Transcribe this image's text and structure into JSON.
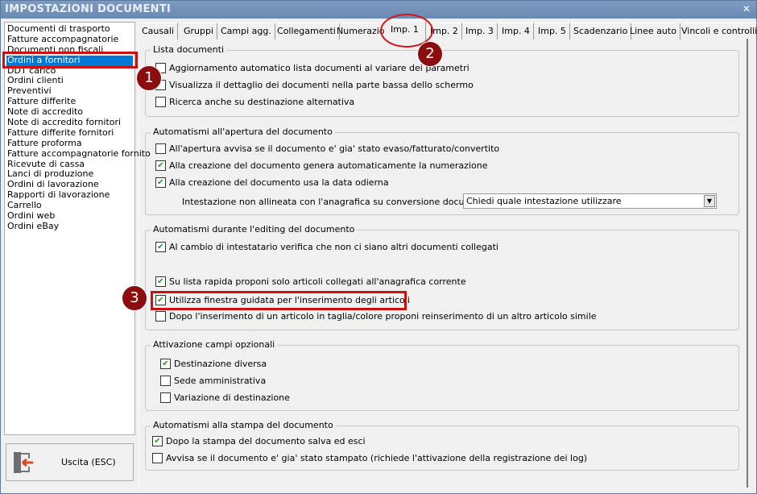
{
  "title": "IMPOSTAZIONI DOCUMENTI",
  "close_label": "✕",
  "doc_list": [
    "Documenti di trasporto",
    "Fatture accompagnatorie",
    "Documenti non fiscali",
    "Ordini a fornitori",
    "DDT carico",
    "Ordini clienti",
    "Preventivi",
    "Fatture differite",
    "Note di accredito",
    "Note di accredito fornitori",
    "Fatture differite fornitori",
    "Fatture proforma",
    "Fatture accompagnatorie fornito",
    "Ricevute di cassa",
    "Lanci di produzione",
    "Ordini di lavorazione",
    "Rapporti di lavorazione",
    "Carrello",
    "Ordini web",
    "Ordini eBay"
  ],
  "selected_doc": "Ordini a fornitori",
  "exit_label": "Uscita (ESC)",
  "tabs": [
    "Causali",
    "Gruppi",
    "Campi agg.",
    "Collegamenti",
    "Numerazioni",
    "Imp. 1",
    "Imp. 2",
    "Imp. 3",
    "Imp. 4",
    "Imp. 5",
    "Scadenzario",
    "Linee auto",
    "Vincoli e controlli"
  ],
  "active_tab": "Imp. 1",
  "groups": {
    "lista": {
      "title": "Lista documenti",
      "items": [
        {
          "label": "Aggiornamento automatico lista documenti al variare dei parametri",
          "checked": false
        },
        {
          "label": "Visualizza il dettaglio dei documenti nella parte bassa dello schermo",
          "checked": false
        },
        {
          "label": "Ricerca anche su destinazione alternativa",
          "checked": false
        }
      ]
    },
    "apertura": {
      "title": "Automatismi all'apertura del documento",
      "items": [
        {
          "label": "All'apertura avvisa se il documento e' gia' stato evaso/fatturato/convertito",
          "checked": false
        },
        {
          "label": "Alla creazione del documento genera automaticamente la numerazione",
          "checked": true
        },
        {
          "label": "Alla creazione del documento usa la data odierna",
          "checked": true
        }
      ],
      "combo_label": "Intestazione non allineata con l'anagrafica su conversione documento :",
      "combo_value": "Chiedi quale intestazione utilizzare"
    },
    "editing": {
      "title": "Automatismi durante l'editing del documento",
      "items": [
        {
          "label": "Al cambio di intestatario verifica che non ci siano altri documenti collegati",
          "checked": true
        },
        {
          "label": "Su lista rapida proponi solo articoli collegati all'anagrafica corrente",
          "checked": true
        },
        {
          "label": "Utilizza finestra guidata per l'inserimento degli articoli",
          "checked": true
        },
        {
          "label": "Dopo l'inserimento di un articolo in taglia/colore proponi reinserimento di un altro articolo simile",
          "checked": false
        }
      ]
    },
    "opzionali": {
      "title": "Attivazione campi opzionali",
      "items": [
        {
          "label": "Destinazione diversa",
          "checked": true
        },
        {
          "label": "Sede amministrativa",
          "checked": false
        },
        {
          "label": "Variazione di destinazione",
          "checked": false
        }
      ]
    },
    "stampa": {
      "title": "Automatismi alla stampa del documento",
      "items": [
        {
          "label": "Dopo la stampa del documento salva ed esci",
          "checked": true
        },
        {
          "label": "Avvisa se il documento e' gia' stato stampato (richiede l'attivazione della registrazione dei log)",
          "checked": false
        }
      ]
    }
  },
  "annotations": [
    "1",
    "2",
    "3"
  ],
  "colors": {
    "accent": "#0078d7",
    "annotation": "#8b0d0d",
    "highlight": "#cc1010",
    "check": "#1a9a1a"
  }
}
